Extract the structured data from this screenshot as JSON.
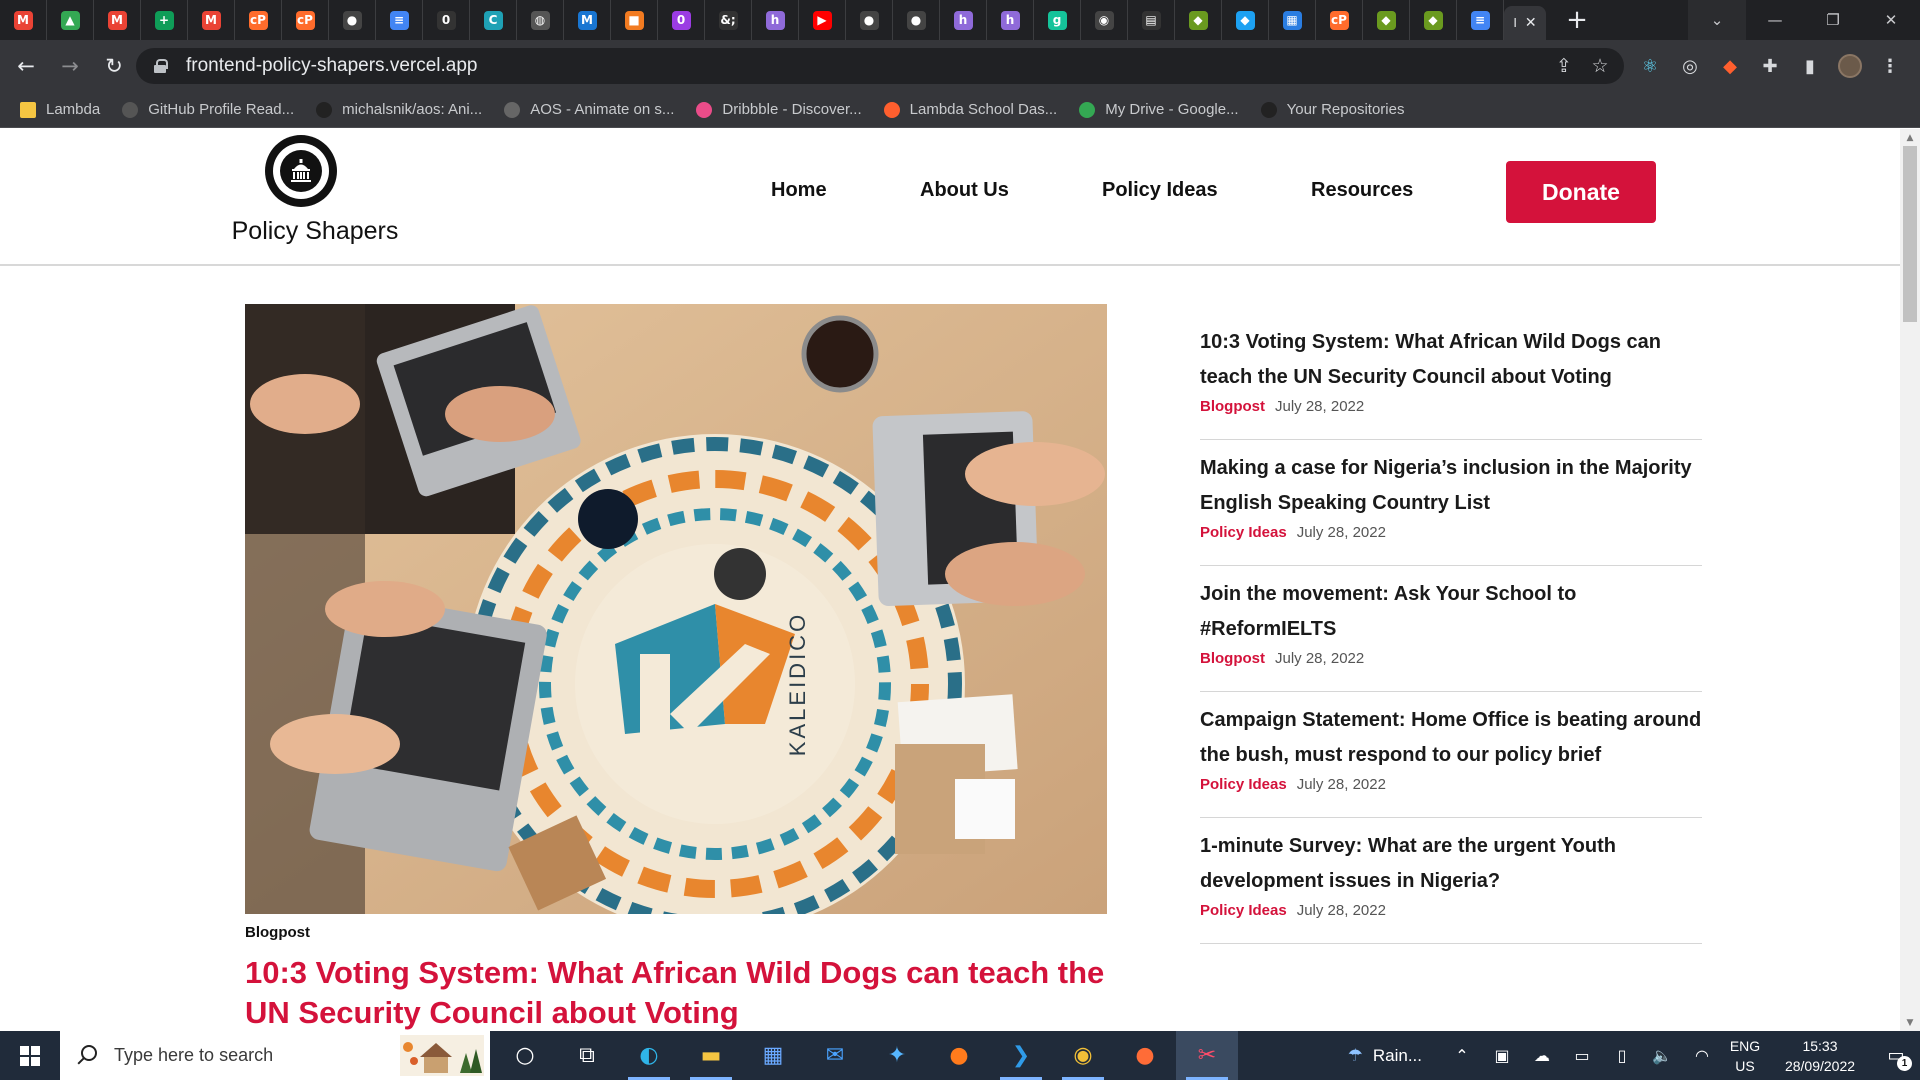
{
  "browser": {
    "tabs": [
      {
        "icon": "gmail-icon",
        "glyph": "M",
        "color": "#ea4335"
      },
      {
        "icon": "google-drive-icon",
        "glyph": "▲",
        "color": "#34a853"
      },
      {
        "icon": "gmail-icon",
        "glyph": "M",
        "color": "#ea4335"
      },
      {
        "icon": "google-sheets-icon",
        "glyph": "+",
        "color": "#0f9d58"
      },
      {
        "icon": "gmail-icon",
        "glyph": "M",
        "color": "#ea4335"
      },
      {
        "icon": "cpanel-icon",
        "glyph": "cP",
        "color": "#ff6c2c"
      },
      {
        "icon": "cpanel-icon",
        "glyph": "cP",
        "color": "#ff6c2c"
      },
      {
        "icon": "github-icon",
        "glyph": "●",
        "color": "#444"
      },
      {
        "icon": "google-docs-icon",
        "glyph": "≡",
        "color": "#4285f4"
      },
      {
        "icon": "notion-icon",
        "glyph": "0",
        "color": "#333"
      },
      {
        "icon": "codewars-icon",
        "glyph": "C",
        "color": "#1fa1b5"
      },
      {
        "icon": "globe-icon",
        "glyph": "◍",
        "color": "#555"
      },
      {
        "icon": "mui-icon",
        "glyph": "M",
        "color": "#1976d2"
      },
      {
        "icon": "package-icon",
        "glyph": "■",
        "color": "#f27b21"
      },
      {
        "icon": "shield-icon",
        "glyph": "0",
        "color": "#9b3ce3"
      },
      {
        "icon": "html-entity-icon",
        "glyph": "&;",
        "color": "#333"
      },
      {
        "icon": "hashnode-icon",
        "glyph": "h",
        "color": "#8f6ad9"
      },
      {
        "icon": "youtube-icon",
        "glyph": "▶",
        "color": "#ff0000"
      },
      {
        "icon": "github-icon",
        "glyph": "●",
        "color": "#444"
      },
      {
        "icon": "github-icon",
        "glyph": "●",
        "color": "#444"
      },
      {
        "icon": "hashnode-icon",
        "glyph": "h",
        "color": "#8f6ad9"
      },
      {
        "icon": "hashnode-icon",
        "glyph": "h",
        "color": "#8f6ad9"
      },
      {
        "icon": "grammarly-icon",
        "glyph": "g",
        "color": "#15c39a"
      },
      {
        "icon": "omnibus-icon",
        "glyph": "◉",
        "color": "#444"
      },
      {
        "icon": "reader-icon",
        "glyph": "▤",
        "color": "#333"
      },
      {
        "icon": "jobberman-icon",
        "glyph": "◆",
        "color": "#6a9a1f"
      },
      {
        "icon": "twitter-icon",
        "glyph": "◆",
        "color": "#1da1f2"
      },
      {
        "icon": "grid-icon",
        "glyph": "▦",
        "color": "#2a7de1"
      },
      {
        "icon": "cpanel-icon",
        "glyph": "cP",
        "color": "#ff6c2c"
      },
      {
        "icon": "jobberman-icon",
        "glyph": "◆",
        "color": "#6a9a1f"
      },
      {
        "icon": "jobberman-icon",
        "glyph": "◆",
        "color": "#6a9a1f"
      },
      {
        "icon": "google-docs-icon",
        "glyph": "≡",
        "color": "#4285f4"
      }
    ],
    "active_tab_glyph": "I",
    "close_glyph": "✕",
    "new_tab_glyph": "+",
    "url": "frontend-policy-shapers.vercel.app",
    "bookmarks": [
      {
        "label": "Lambda",
        "icon": "folder-icon",
        "color": "#f5c542"
      },
      {
        "label": "GitHub Profile Read...",
        "icon": "mdg-icon",
        "color": "#555"
      },
      {
        "label": "michalsnik/aos: Ani...",
        "icon": "github-icon",
        "color": "#222"
      },
      {
        "label": "AOS - Animate on s...",
        "icon": "globe-icon",
        "color": "#666"
      },
      {
        "label": "Dribbble - Discover...",
        "icon": "dribbble-icon",
        "color": "#ea4c89"
      },
      {
        "label": "Lambda School Das...",
        "icon": "lambda-icon",
        "color": "#ff5f2e"
      },
      {
        "label": "My Drive - Google...",
        "icon": "google-drive-icon",
        "color": "#34a853"
      },
      {
        "label": "Your Repositories",
        "icon": "github-icon",
        "color": "#222"
      }
    ]
  },
  "site": {
    "brand": "Policy Shapers",
    "nav": [
      {
        "label": "Home",
        "name": "nav-home"
      },
      {
        "label": "About Us",
        "name": "nav-about-us"
      },
      {
        "label": "Policy Ideas",
        "name": "nav-policy-ideas"
      },
      {
        "label": "Resources",
        "name": "nav-resources"
      }
    ],
    "donate_label": "Donate",
    "accent_color": "#d4123b",
    "hero": {
      "category": "Blogpost",
      "title": "10:3 Voting System: What African Wild Dogs can teach the UN Security Council about Voting",
      "image_text": "KALEIDICO"
    },
    "posts": [
      {
        "title": "10:3 Voting System: What African Wild Dogs can teach the UN Security Council about Voting",
        "category": "Blogpost",
        "date": "July 28, 2022"
      },
      {
        "title": "Making a case for Nigeria’s inclusion in the Majority English Speaking Country List",
        "category": "Policy Ideas",
        "date": "July 28, 2022"
      },
      {
        "title": "Join the movement: Ask Your School to #ReformIELTS",
        "category": "Blogpost",
        "date": "July 28, 2022"
      },
      {
        "title": "Campaign Statement: Home Office is beating around the bush, must respond to our policy brief",
        "category": "Policy Ideas",
        "date": "July 28, 2022"
      },
      {
        "title": "1-minute Survey: What are the urgent Youth development issues in Nigeria?",
        "category": "Policy Ideas",
        "date": "July 28, 2022"
      }
    ]
  },
  "taskbar": {
    "search_placeholder": "Type here to search",
    "weather": "Rain...",
    "lang_top": "ENG",
    "lang_bottom": "US",
    "time": "15:33",
    "date": "28/09/2022",
    "notification_count": "1",
    "apps": [
      {
        "name": "cortana-icon",
        "glyph": "○"
      },
      {
        "name": "task-view-icon",
        "glyph": "⧉"
      },
      {
        "name": "edge-icon",
        "glyph": "◐"
      },
      {
        "name": "file-explorer-icon",
        "glyph": "▬"
      },
      {
        "name": "microsoft-store-icon",
        "glyph": "▦"
      },
      {
        "name": "mail-icon",
        "glyph": "✉"
      },
      {
        "name": "safari-icon",
        "glyph": "✦"
      },
      {
        "name": "firefox-icon",
        "glyph": "●"
      },
      {
        "name": "vscode-icon",
        "glyph": "❯"
      },
      {
        "name": "chrome-icon",
        "glyph": "◉"
      },
      {
        "name": "postman-icon",
        "glyph": "●"
      },
      {
        "name": "snipping-tool-icon",
        "glyph": "✂"
      }
    ]
  }
}
